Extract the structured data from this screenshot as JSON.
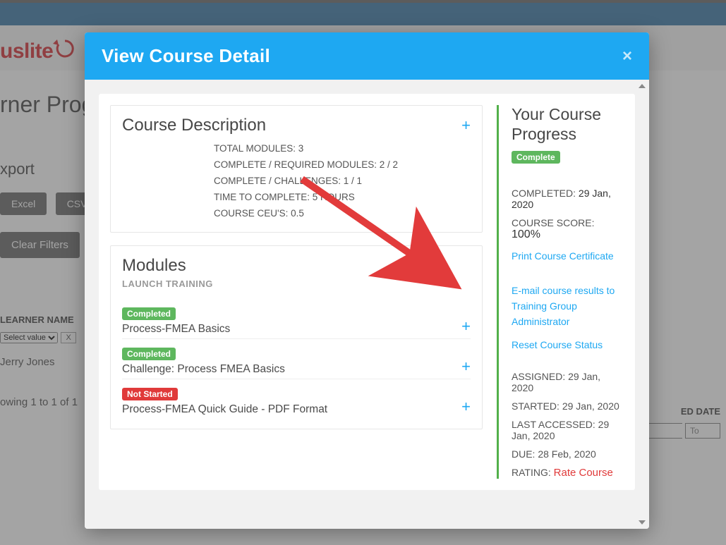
{
  "brand": "uslite",
  "background": {
    "page_title_fragment": "rner Prog",
    "section_label": "xport",
    "export_excel": "Excel",
    "export_csv": "CSV",
    "clear_filters": "Clear Filters",
    "th_learner": "LEARNER NAME",
    "th_completed_date": "ED DATE",
    "filter_select": "Select value",
    "filter_x": "X",
    "cell_name": "Jerry Jones",
    "footer": "owing 1 to 1 of 1",
    "to_placeholder": "To"
  },
  "modal": {
    "title": "View Course Detail",
    "close": "×",
    "course_desc": {
      "heading": "Course Description",
      "stats": {
        "total_modules": "TOTAL MODULES: 3",
        "complete_required": "COMPLETE / REQUIRED MODULES: 2 / 2",
        "complete_challenges": "COMPLETE / CHALLENGES: 1 / 1",
        "time_to_complete": "TIME TO COMPLETE: 5 HOURS",
        "ceus": "COURSE CEU'S: 0.5"
      }
    },
    "modules": {
      "heading": "Modules",
      "subheading": "LAUNCH TRAINING",
      "items": [
        {
          "status": "Completed",
          "status_class": "green",
          "name": "Process-FMEA Basics"
        },
        {
          "status": "Completed",
          "status_class": "green",
          "name": "Challenge: Process FMEA Basics"
        },
        {
          "status": "Not Started",
          "status_class": "red",
          "name": "Process-FMEA Quick Guide - PDF Format"
        }
      ]
    },
    "progress": {
      "heading": "Your Course Progress",
      "status_badge": "Complete",
      "completed_label": "COMPLETED:",
      "completed_value": "29 Jan, 2020",
      "score_label": "COURSE SCORE:",
      "score_value": "100%",
      "print_cert": "Print Course Certificate",
      "email_results": "E-mail course results to Training Group Administrator",
      "reset_status": "Reset Course Status",
      "assigned": "ASSIGNED: 29 Jan, 2020",
      "started": "STARTED: 29 Jan, 2020",
      "last_accessed": "LAST ACCESSED: 29 Jan, 2020",
      "due": "DUE: 28 Feb, 2020",
      "rating_label": "RATING:",
      "rate_course": "Rate Course"
    }
  },
  "annotation": {
    "arrow_color": "#e23b3b"
  }
}
